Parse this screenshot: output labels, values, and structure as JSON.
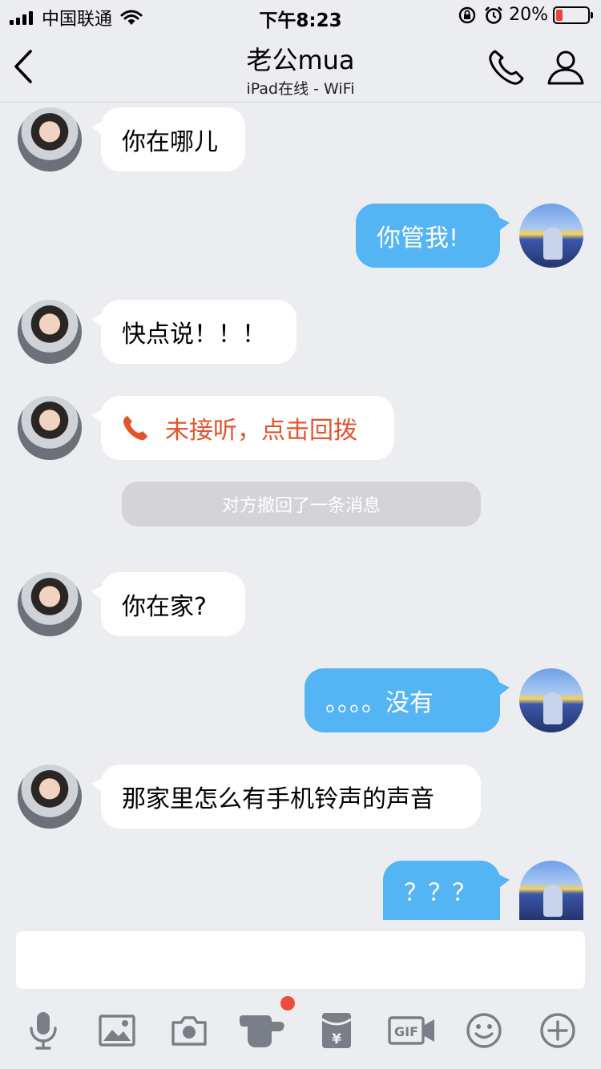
{
  "status_bar": {
    "carrier": "中国联通",
    "time": "下午8:23",
    "battery_pct": "20%",
    "battery_level": 0.2,
    "battery_color": "#e8423a"
  },
  "nav": {
    "title": "老公mua",
    "subtitle": "iPad在线 - WiFi",
    "icons": [
      "back-icon",
      "phone-icon",
      "profile-icon"
    ]
  },
  "messages": [
    {
      "side": "in",
      "text": "你在哪儿"
    },
    {
      "side": "out",
      "text": "你管我!"
    },
    {
      "side": "in",
      "text": "快点说！！！"
    },
    {
      "side": "in",
      "type": "missed_call",
      "text": "未接听，点击回拨"
    },
    {
      "side": "system",
      "text": "对方撤回了一条消息"
    },
    {
      "side": "in",
      "text": "你在家?"
    },
    {
      "side": "out",
      "text": "。。。。没有"
    },
    {
      "side": "in",
      "text": "那家里怎么有手机铃声的声音"
    },
    {
      "side": "out",
      "text": "？？？"
    }
  ],
  "toolbar": {
    "icons": [
      "microphone-icon",
      "image-icon",
      "camera-icon",
      "poke-icon",
      "red-packet-icon",
      "gif-icon",
      "emoji-icon",
      "plus-icon"
    ],
    "gif_label": "GIF",
    "red_packet_symbol": "¥"
  },
  "colors": {
    "outgoing_bubble": "#55b4f3",
    "incoming_bubble": "#ffffff",
    "missed_call": "#e5532e",
    "background": "#ecedf1"
  }
}
